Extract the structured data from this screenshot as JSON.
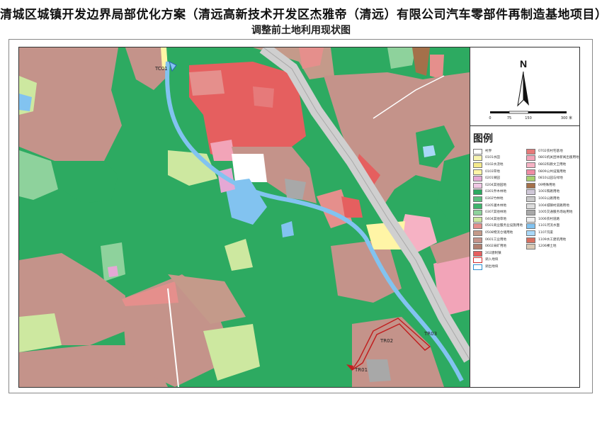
{
  "title": "清城区城镇开发边界局部优化方案（清远高新技术开发区杰雅帝（清远）有限公司汽车零部件再制造基地项目）",
  "subtitle": "调整前土地利用现状图",
  "north_label": "N",
  "scale_labels": [
    "0",
    "75",
    "150",
    "300 米"
  ],
  "legend_title": "图例",
  "legend_left": [
    {
      "label": "村界",
      "color": "#ffffff"
    },
    {
      "label": "0101水田",
      "color": "#f7f4b0"
    },
    {
      "label": "0102水浇地",
      "color": "#f5e98c"
    },
    {
      "label": "0103旱地",
      "color": "#fff5a6"
    },
    {
      "label": "0201果园",
      "color": "#e5a8d5"
    },
    {
      "label": "0204其他园地",
      "color": "#f0c8e4"
    },
    {
      "label": "0301乔木林地",
      "color": "#2daa61"
    },
    {
      "label": "0302竹林地",
      "color": "#5cc07e"
    },
    {
      "label": "0305灌木林地",
      "color": "#3fb46c"
    },
    {
      "label": "0307其他林地",
      "color": "#8ed29c"
    },
    {
      "label": "0404其他草地",
      "color": "#cde8a0"
    },
    {
      "label": "0501商业服务业设施用地",
      "color": "#e58f8c"
    },
    {
      "label": "0508物流仓储用地",
      "color": "#c49a8a"
    },
    {
      "label": "0601工业用地",
      "color": "#c4938a"
    },
    {
      "label": "0602采矿用地",
      "color": "#b08070"
    },
    {
      "label": "202建制镇",
      "color": "#e55f5f"
    },
    {
      "label": "调入地块",
      "color": "#ffffff",
      "border": "#d03030"
    },
    {
      "label": "调出地块",
      "color": "#ffffff",
      "border": "#3090d0"
    }
  ],
  "legend_right": [
    {
      "label": "0702农村宅基地",
      "color": "#e67a7a"
    },
    {
      "label": "0801机关团体新闻出版用地",
      "color": "#f2a4b8"
    },
    {
      "label": "0802科教文卫用地",
      "color": "#f6b2c4"
    },
    {
      "label": "0809公共设施用地",
      "color": "#f08ca4"
    },
    {
      "label": "0810公园与绿地",
      "color": "#a8d070"
    },
    {
      "label": "09特殊用地",
      "color": "#a4704a"
    },
    {
      "label": "1001铁路用地",
      "color": "#d0c8d8"
    },
    {
      "label": "1003公路用地",
      "color": "#c8c8c8"
    },
    {
      "label": "1004城镇村道路用地",
      "color": "#dcdcdc"
    },
    {
      "label": "1005交通服务场站用地",
      "color": "#a8a8a8"
    },
    {
      "label": "1006农村道路",
      "color": "#eeeeee"
    },
    {
      "label": "1101河流水面",
      "color": "#82c3f0"
    },
    {
      "label": "1107沟渠",
      "color": "#a8d8f8"
    },
    {
      "label": "1109水工建筑用地",
      "color": "#d87060"
    },
    {
      "label": "1206裸土地",
      "color": "#d8c8b4"
    }
  ],
  "map_labels": [
    "TC01",
    "TR01",
    "TR02",
    "TR03"
  ]
}
